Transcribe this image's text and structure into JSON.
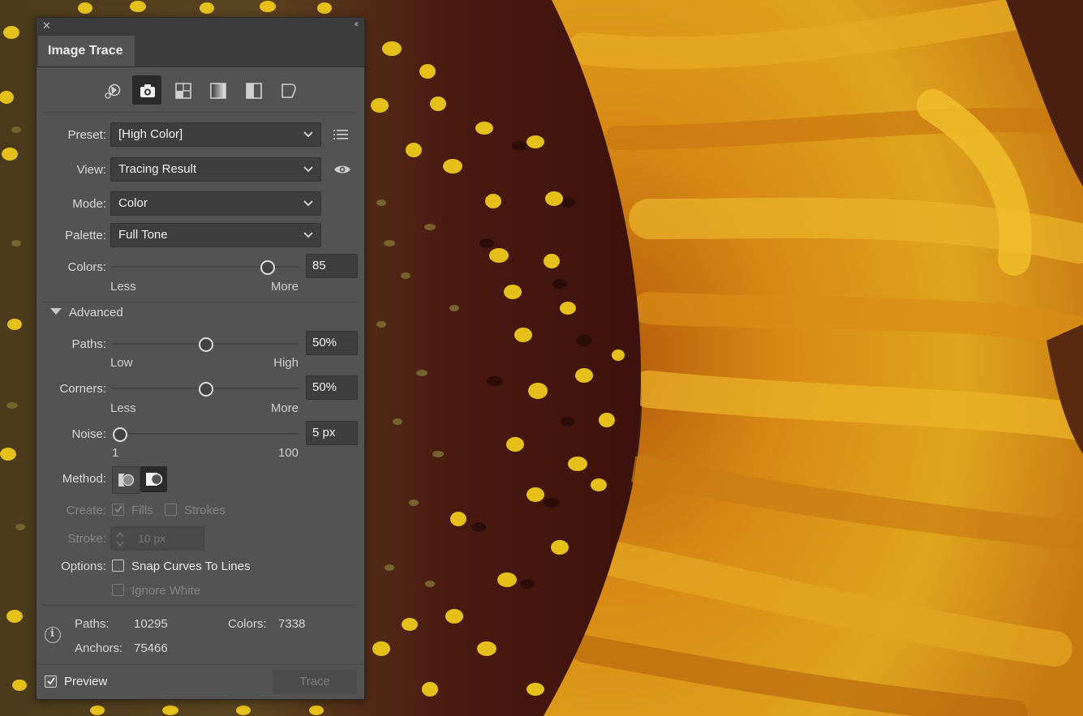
{
  "panel": {
    "title": "Image Trace",
    "close_glyph": "✕",
    "collapse_glyph": "‹‹"
  },
  "toolbar_icons": [
    {
      "name": "auto-color-preset-icon",
      "selected": false
    },
    {
      "name": "high-color-preset-icon",
      "selected": true
    },
    {
      "name": "low-color-preset-icon",
      "selected": false
    },
    {
      "name": "grayscale-preset-icon",
      "selected": false
    },
    {
      "name": "black-and-white-preset-icon",
      "selected": false
    },
    {
      "name": "outline-preset-icon",
      "selected": false
    }
  ],
  "preset": {
    "label": "Preset:",
    "value": "[High Color]"
  },
  "view": {
    "label": "View:",
    "value": "Tracing Result"
  },
  "mode": {
    "label": "Mode:",
    "value": "Color"
  },
  "palette": {
    "label": "Palette:",
    "value": "Full Tone"
  },
  "colors": {
    "label": "Colors:",
    "value": "85",
    "min_label": "Less",
    "max_label": "More",
    "level": 0.83
  },
  "advanced": {
    "label": "Advanced"
  },
  "paths": {
    "label": "Paths:",
    "value": "50%",
    "min_label": "Low",
    "max_label": "High",
    "level": 0.5
  },
  "corners": {
    "label": "Corners:",
    "value": "50%",
    "min_label": "Less",
    "max_label": "More",
    "level": 0.5
  },
  "noise": {
    "label": "Noise:",
    "value": "5 px",
    "min_label": "1",
    "max_label": "100",
    "level": 0.04
  },
  "method": {
    "label": "Method:",
    "options": [
      "abutting-method-icon",
      "overlapping-method-icon"
    ],
    "selected": 1
  },
  "create": {
    "label": "Create:",
    "fills_label": "Fills",
    "fills_checked": true,
    "strokes_label": "Strokes",
    "strokes_checked": false
  },
  "stroke": {
    "label": "Stroke:",
    "value": "10 px"
  },
  "options": {
    "label": "Options:",
    "snap_label": "Snap Curves To Lines",
    "snap_checked": false,
    "ignore_white_label": "Ignore White",
    "ignore_white_checked": false
  },
  "stats": {
    "paths_label": "Paths:",
    "paths_value": "10295",
    "colors_label": "Colors:",
    "colors_value": "7338",
    "anchors_label": "Anchors:",
    "anchors_value": "75466"
  },
  "footer": {
    "preview_label": "Preview",
    "preview_checked": true,
    "trace_label": "Trace"
  },
  "colors_theme": {
    "panel_bg": "#535353",
    "field_bg": "#3e3e3e",
    "petal_yellow": "#d89a1a",
    "petal_dark": "#b86810",
    "seed_dark": "#3a1410",
    "pollen_yellow": "#e8c21a"
  }
}
